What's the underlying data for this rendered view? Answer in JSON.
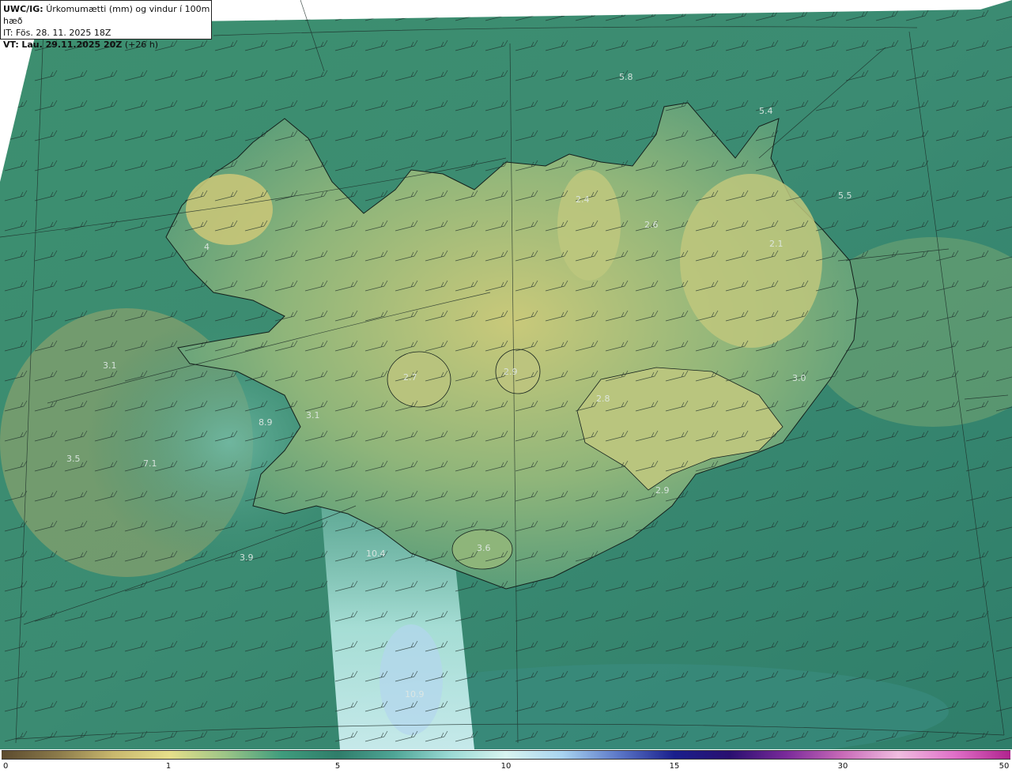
{
  "header": {
    "product": "UWC/IG:",
    "title": "Úrkomumætti (mm) og vindur í 100m hæð",
    "it_prefix": "IT:",
    "it_value": "Fös. 28. 11. 2025 18Z",
    "vt_prefix": "VT:",
    "vt_value": "Lau. 29.11.2025 20Z",
    "vt_offset": "(+26 h)"
  },
  "map_labels": [
    "5.8",
    "5.4",
    "5.5",
    "2.4",
    "2.6",
    "2.1",
    "3.1",
    "2.7",
    "2.9",
    "2.8",
    "3.0",
    "8.9",
    "3.1",
    "3.5",
    "7.1",
    "2.9",
    "3.6",
    "10.4",
    "3.9",
    "10.9",
    "4"
  ],
  "colorbar": {
    "ticks": [
      "0",
      "1",
      "5",
      "10",
      "15",
      "30",
      "50"
    ],
    "colors": [
      "#5b4a2e",
      "#8b7a4a",
      "#c9b86e",
      "#e6df8a",
      "#9cc587",
      "#3f9c7d",
      "#2f7d6a",
      "#4fa596",
      "#9ad9d4",
      "#d8f4f0",
      "#a9d4f0",
      "#5c78c8",
      "#1a1f8c",
      "#2a1070",
      "#7a2a9a",
      "#c86ab8",
      "#f0bde0",
      "#e070c8",
      "#b0238e"
    ]
  }
}
